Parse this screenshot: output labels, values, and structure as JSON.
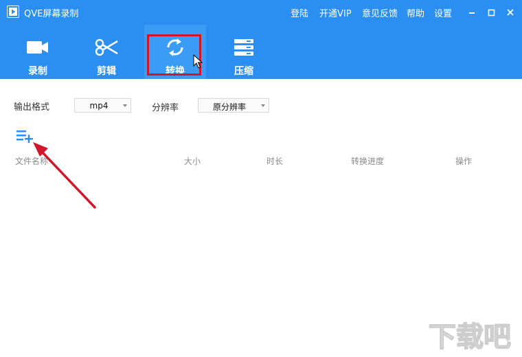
{
  "window": {
    "title": "QVE屏幕录制",
    "menu": [
      "登陆",
      "开通VIP",
      "意见反馈",
      "帮助",
      "设置"
    ]
  },
  "toolbar": {
    "items": [
      {
        "label": "录制",
        "icon": "video-camera-icon"
      },
      {
        "label": "剪辑",
        "icon": "scissors-icon"
      },
      {
        "label": "转换",
        "icon": "convert-refresh-icon",
        "active": true
      },
      {
        "label": "压缩",
        "icon": "compress-icon"
      }
    ],
    "accent": "#2a8ff0",
    "highlight_color": "#d0162a"
  },
  "settings": {
    "format_label": "输出格式",
    "format_value": "mp4",
    "resolution_label": "分辨率",
    "resolution_value": "原分辨率"
  },
  "add_button": {
    "icon": "add-list-icon"
  },
  "table": {
    "columns": [
      "文件名称",
      "大小",
      "时长",
      "转换进度",
      "操作"
    ],
    "rows": []
  },
  "watermark": {
    "text": "下载吧"
  }
}
